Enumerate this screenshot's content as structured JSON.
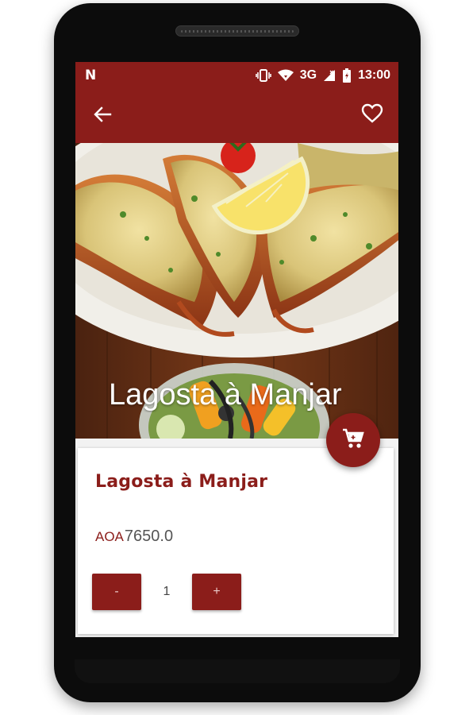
{
  "status_bar": {
    "notification_icon": "N",
    "network": "3G",
    "time": "13:00",
    "icons": [
      "vibrate-icon",
      "wifi-icon",
      "signal-icon",
      "battery-icon"
    ]
  },
  "app_bar": {
    "back_icon": "arrow-left-icon",
    "favorite_icon": "heart-outline-icon"
  },
  "hero": {
    "title": "Lagosta à Manjar"
  },
  "product": {
    "name": "Lagosta à Manjar",
    "currency": "AOA",
    "price": "7650.0"
  },
  "quantity": {
    "decrement_label": "-",
    "value": "1",
    "increment_label": "+"
  },
  "cart_button": {
    "icon": "cart-icon"
  },
  "colors": {
    "primary": "#8b1d1a",
    "text_gray": "#555555",
    "background": "#f2f2f2"
  }
}
